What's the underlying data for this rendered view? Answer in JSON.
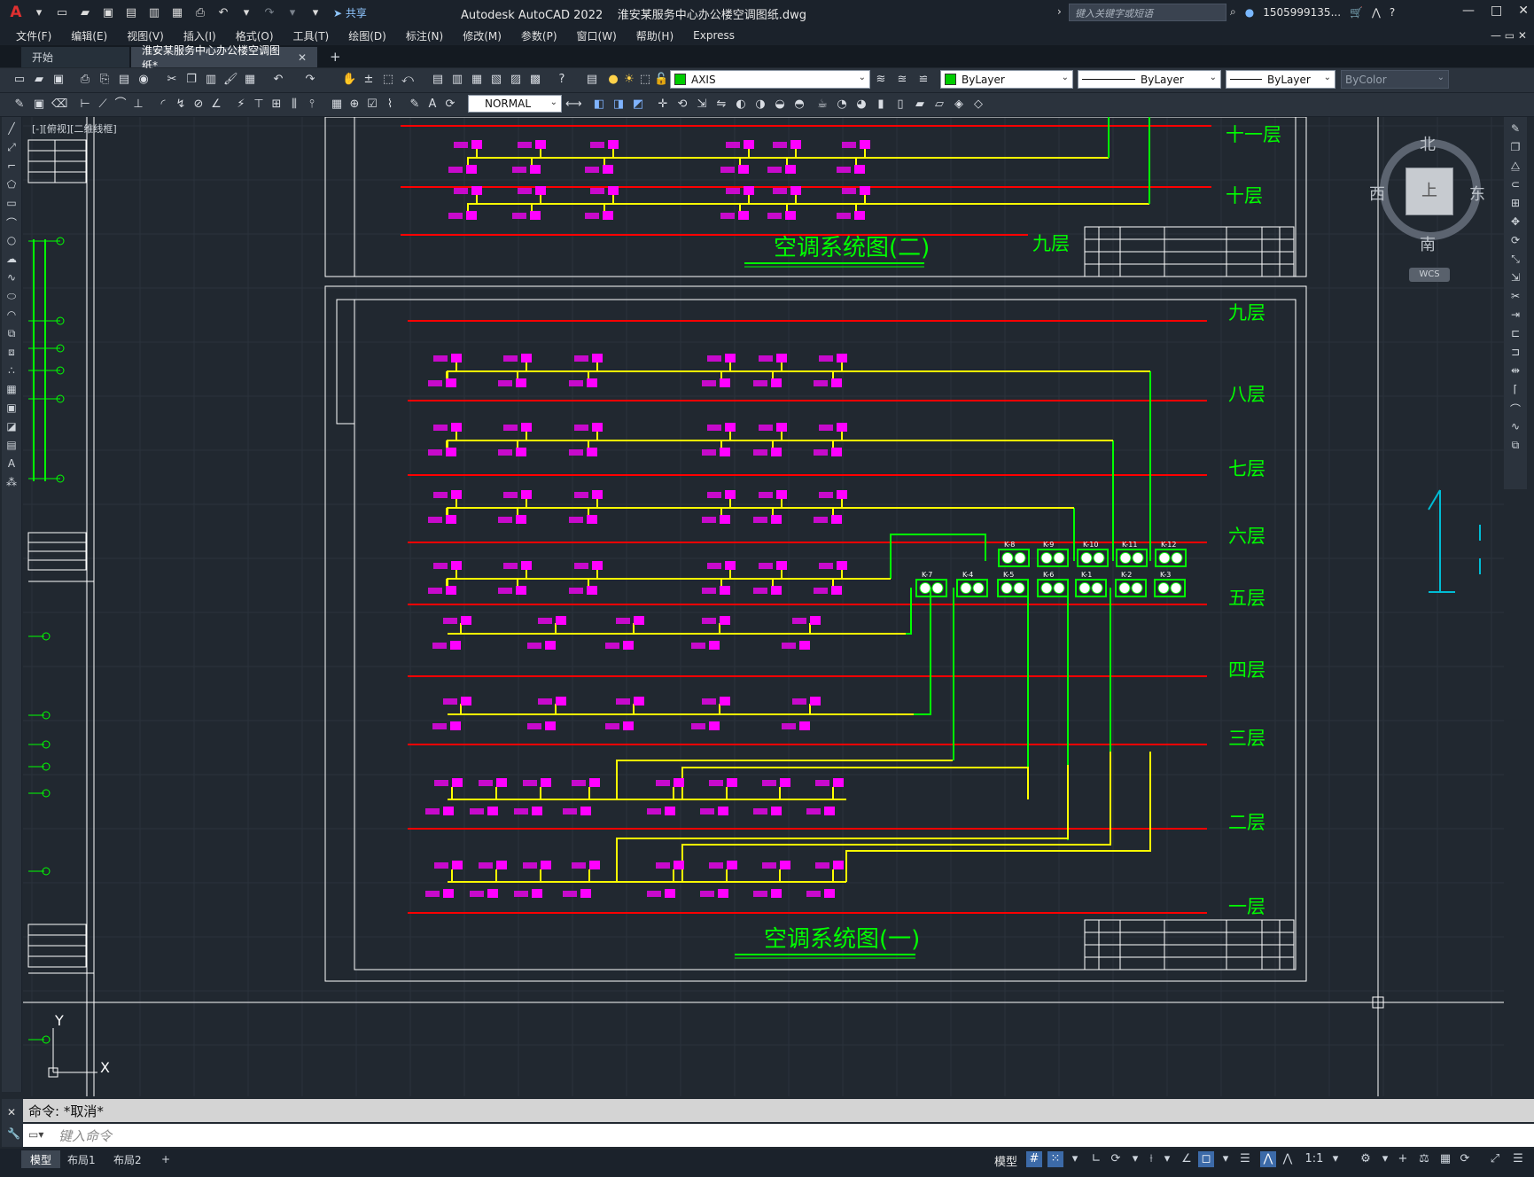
{
  "app": {
    "title": "Autodesk AutoCAD 2022    淮安某服务中心办公楼空调图纸.dwg",
    "logo": "A",
    "share_label": "共享",
    "search_placeholder": "键入关键字或短语",
    "user": "1505999135...",
    "window_controls": [
      "—",
      "□",
      "✕"
    ]
  },
  "menu": [
    "文件(F)",
    "编辑(E)",
    "视图(V)",
    "插入(I)",
    "格式(O)",
    "工具(T)",
    "绘图(D)",
    "标注(N)",
    "修改(M)",
    "参数(P)",
    "窗口(W)",
    "帮助(H)",
    "Express"
  ],
  "tabs": {
    "start": "开始",
    "active": "淮安某服务中心办公楼空调图纸*",
    "close": "✕",
    "add": "+"
  },
  "toolbar": {
    "layer": "AXIS",
    "color": "ByLayer",
    "linetype": "ByLayer",
    "lineweight": "ByLayer",
    "plotstyle": "ByColor",
    "dimstyle": "NORMAL",
    "layer_color": "#00cc00"
  },
  "viewport": {
    "label": "[-][俯视][二维线框]"
  },
  "viewcube": {
    "north": "北",
    "south": "南",
    "east": "东",
    "west": "西",
    "face": "上",
    "wcs": "WCS"
  },
  "drawing": {
    "upper_title": "空调系统图(二)",
    "lower_title": "空调系统图(一)",
    "upper_floors": [
      "十一层",
      "十层",
      "九层"
    ],
    "lower_floors": [
      "九层",
      "八层",
      "七层",
      "六层",
      "五层",
      "四层",
      "三层",
      "二层",
      "一层"
    ],
    "units_row1": [
      "K-8",
      "K-9",
      "K-10",
      "K-11",
      "K-12"
    ],
    "units_row2": [
      "K-7",
      "K-4",
      "K-5",
      "K-6",
      "K-1",
      "K-2",
      "K-3"
    ],
    "ucs": {
      "y": "Y",
      "x": "X"
    },
    "colors": {
      "floor_line": "#ff0000",
      "pipe": "#ffff00",
      "riser": "#00ff00",
      "unit": "#ff00ff",
      "frame": "#ffffff",
      "label": "#00ff00"
    }
  },
  "command": {
    "history": "命令: *取消*",
    "placeholder": "键入命令"
  },
  "layouts": [
    "模型",
    "布局1",
    "布局2"
  ],
  "status": {
    "model": "模型",
    "scale": "1:1"
  }
}
